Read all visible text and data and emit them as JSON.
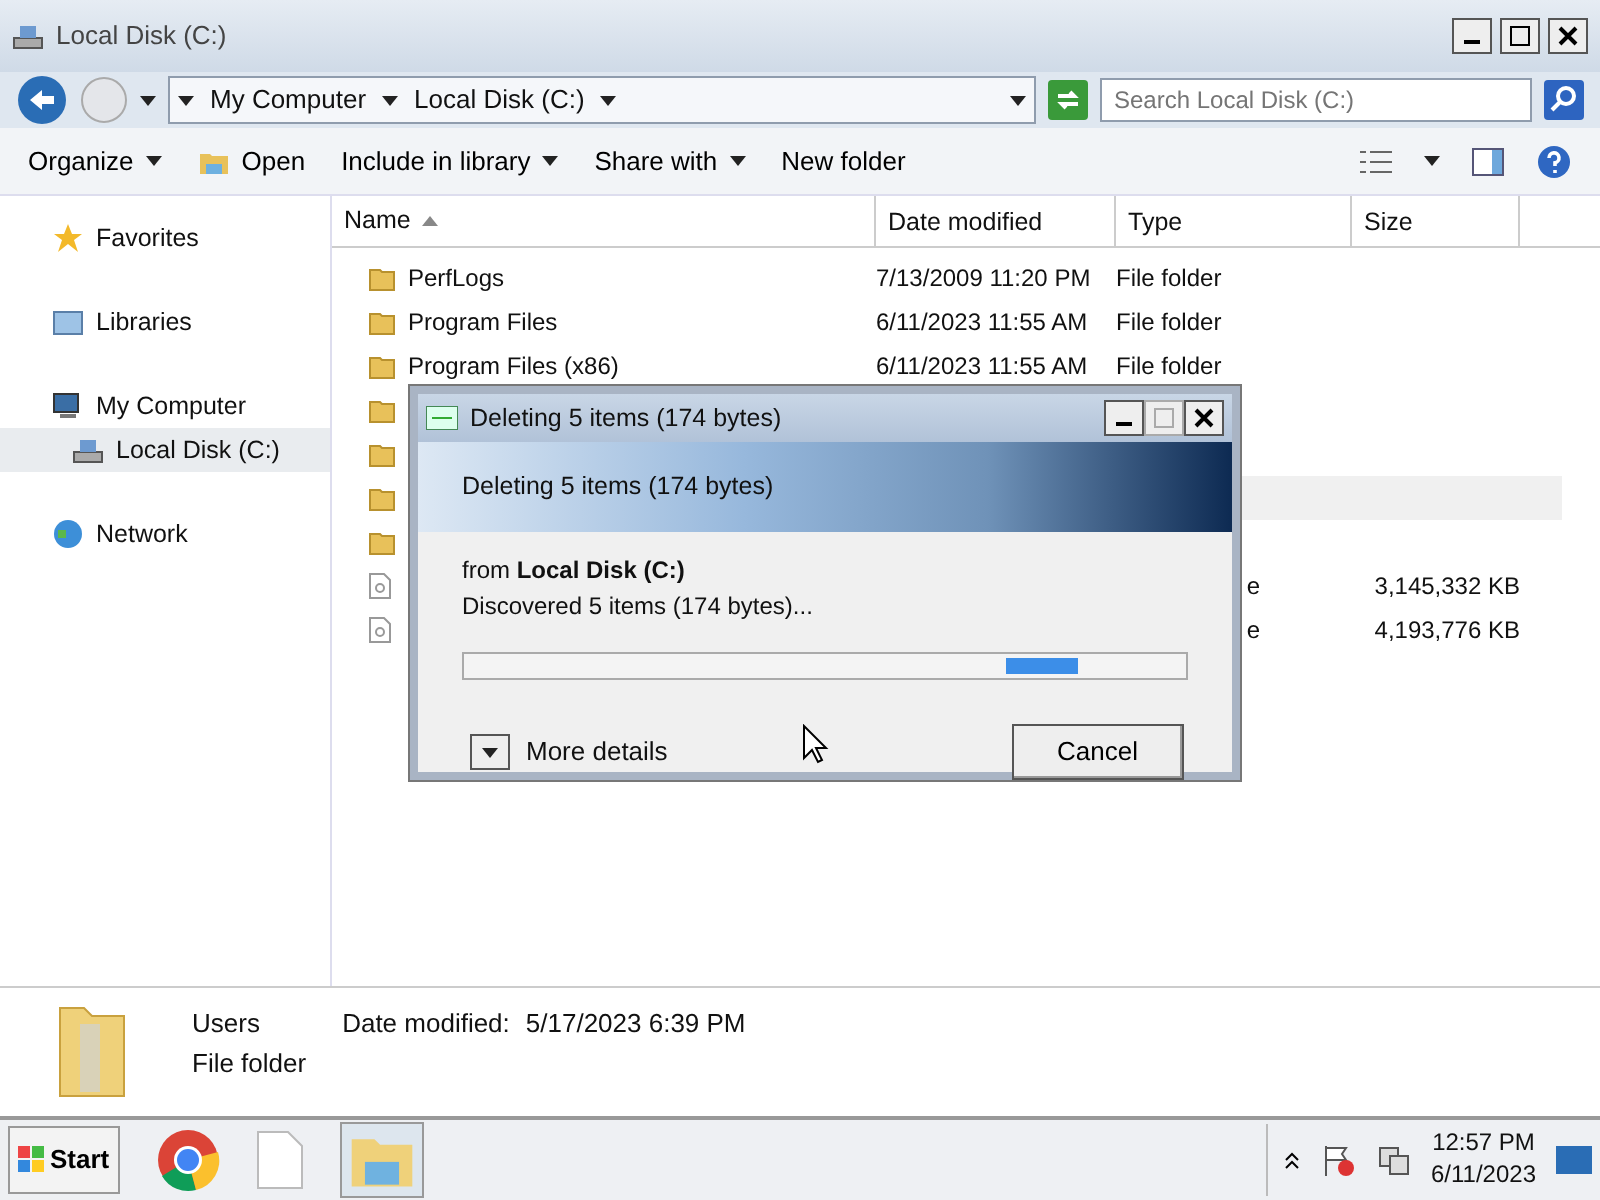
{
  "window": {
    "title": "Local Disk (C:)"
  },
  "address": {
    "crumbs": [
      "My Computer",
      "Local Disk (C:)"
    ],
    "search_placeholder": "Search Local Disk (C:)"
  },
  "toolbar": [
    {
      "label": "Organize",
      "kind": "menu"
    },
    {
      "label": "Open",
      "kind": "icon"
    },
    {
      "label": "Include in library",
      "kind": "menu"
    },
    {
      "label": "Share with",
      "kind": "menu"
    },
    {
      "label": "New folder",
      "kind": "plain"
    }
  ],
  "nav": [
    {
      "label": "Favorites",
      "kind": "star",
      "selected": false
    },
    {
      "label": "Libraries",
      "kind": "library",
      "selected": false
    },
    {
      "label": "My Computer",
      "kind": "computer",
      "selected": false,
      "children": [
        {
          "label": "Local Disk (C:)",
          "kind": "disk",
          "selected": true
        }
      ]
    },
    {
      "label": "Network",
      "kind": "network",
      "selected": false
    }
  ],
  "table": {
    "columns": [
      "Name",
      "Date modified",
      "Type",
      "Size"
    ],
    "rows": [
      {
        "kind": "folder",
        "name": "PerfLogs",
        "date": "7/13/2009 11:20 PM",
        "type": "File folder",
        "selected": false
      },
      {
        "kind": "folder",
        "name": "Program Files",
        "date": "6/11/2023 11:55 AM",
        "type": "File folder",
        "selected": false
      },
      {
        "kind": "folder",
        "name": "Program Files (x86)",
        "date": "6/11/2023 11:55 AM",
        "type": "File folder",
        "selected": false
      },
      {
        "kind": "folder",
        "selected": false
      },
      {
        "kind": "folder",
        "selected": false
      },
      {
        "kind": "folder",
        "selected": true
      },
      {
        "kind": "folder",
        "selected": false
      },
      {
        "kind": "file",
        "type": "e",
        "size": "3,145,332 KB",
        "selected": false
      },
      {
        "kind": "file",
        "type": "e",
        "size": "4,193,776 KB",
        "selected": false
      }
    ]
  },
  "details": {
    "name": "Users",
    "label": "Date modified:",
    "date": "5/17/2023 6:39 PM",
    "type": "File folder"
  },
  "dialog": {
    "title": "Deleting 5 items (174 bytes)",
    "header": "Deleting 5 items (174 bytes)",
    "from": "from **Local Disk (C:)**",
    "status": "Discovered 5 items (174 bytes)...",
    "level": 0.85,
    "more": "More details",
    "cancel": "Cancel"
  },
  "taskbar": {
    "start": "Start",
    "time": "12:57 PM",
    "date": "6/11/2023"
  }
}
